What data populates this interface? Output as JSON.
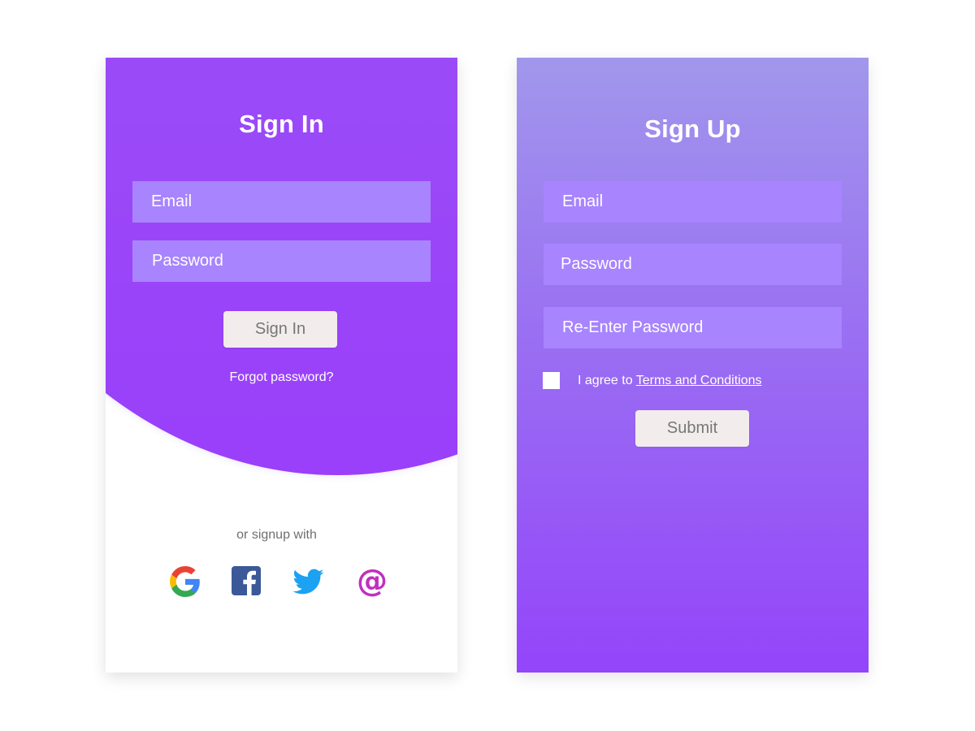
{
  "signin": {
    "title": "Sign In",
    "email_placeholder": "Email",
    "password_placeholder": "Password",
    "button_label": "Sign In",
    "forgot_label": "Forgot password?",
    "or_signup_label": "or signup with",
    "social": [
      {
        "icon": "google-icon"
      },
      {
        "icon": "facebook-icon"
      },
      {
        "icon": "twitter-icon"
      },
      {
        "icon": "at-sign-icon"
      }
    ]
  },
  "signup": {
    "title": "Sign Up",
    "email_placeholder": "Email",
    "password_placeholder": "Password",
    "reenter_placeholder": "Re-Enter Password",
    "agree_prefix": "I agree to ",
    "terms_label": "Terms and Conditions",
    "button_label": "Submit"
  },
  "colors": {
    "gradient_top": "#a197ec",
    "gradient_bottom": "#9445fa",
    "field_bg": "#a884fe",
    "button_bg": "#f2ecec",
    "facebook": "#3b5998",
    "twitter": "#1da1f2",
    "at_sign": "#c030c0"
  }
}
